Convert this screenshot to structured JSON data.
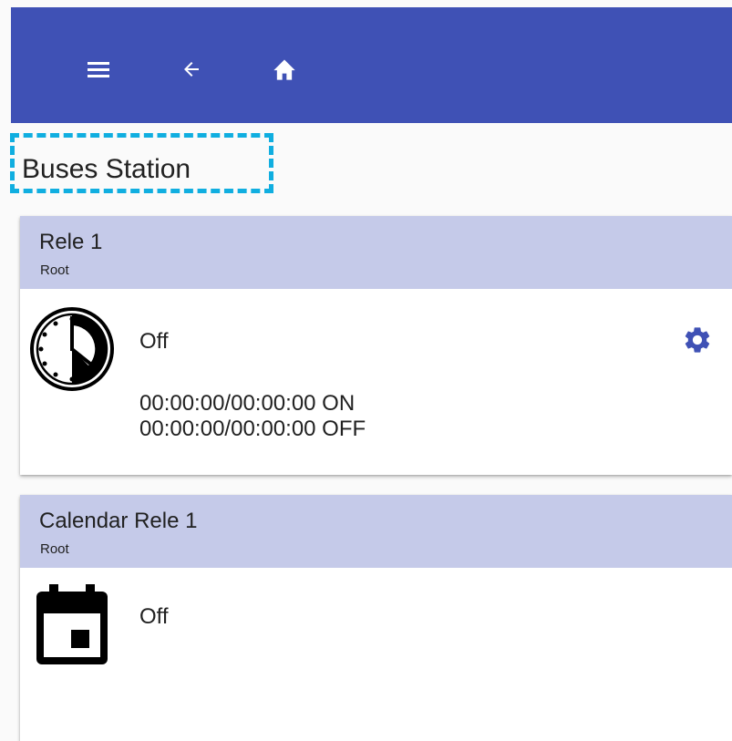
{
  "topbar": {
    "background_color": "#3f51b5",
    "icons": [
      "menu-icon",
      "arrow-back-icon",
      "home-icon"
    ]
  },
  "page": {
    "title": "Buses Station",
    "title_highlight_color": "#10aee0"
  },
  "cards": [
    {
      "title": "Rele 1",
      "subtitle": "Root",
      "icon": "clock-icon",
      "state": "Off",
      "schedule": [
        "00:00:00/00:00:00 ON",
        "00:00:00/00:00:00 OFF"
      ],
      "action_icon": "gear-icon",
      "header_color": "#c5cae9"
    },
    {
      "title": "Calendar Rele 1",
      "subtitle": "Root",
      "icon": "calendar-icon",
      "state": "Off",
      "header_color": "#c5cae9"
    }
  ]
}
